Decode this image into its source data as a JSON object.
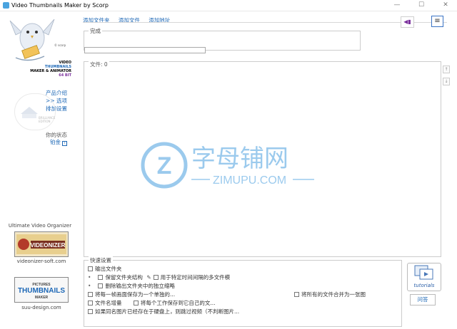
{
  "window": {
    "title": "Video Thumbnails Maker by Scorp",
    "minimize_glyph": "—",
    "maximize_glyph": "☐",
    "close_glyph": "✕"
  },
  "sidebar": {
    "scorp_label": "© scorp",
    "logo_lines": [
      "VIDEO",
      "THUMBNAILS",
      "MAKER & ANIMATOR",
      "64 BIT"
    ],
    "product_intro": "产品介绍",
    "options": ">> 选项",
    "reset": "排加设置",
    "edition_text": [
      "BRILLIANCE",
      "EDITION"
    ],
    "your_status": "你的状态",
    "platinum": "铂金",
    "info_glyph": "i",
    "org_label": "Ultimate Video Organizer",
    "videonizer_logo_text": "VIDEONIZER",
    "videonizer_link": "videonizer-soft.com",
    "ptm_logo_lines": [
      "PICTURES",
      "THUMBNAILS",
      "MAKER"
    ],
    "ptm_link": "suu-design.com"
  },
  "toolbar": {
    "add_folder": "添加文件夹",
    "add_file": "添加文件",
    "add_address": "添加地址"
  },
  "status": {
    "legend": "完成"
  },
  "files": {
    "label": "文件: 0"
  },
  "quick_settings": {
    "legend": "快速设置",
    "output_folder": "输出文件夹",
    "keep_structure": "保留文件夹结构",
    "multi_file_interval": "用于特定时间间隔的多文件模",
    "delete_thumbs": "删除输出文件夹中的独立缩略",
    "each_frame_separate": "将每一帧画面保存为一个单独的...",
    "merge_all": "将所有的文件合并为一张图",
    "file_name_inc": "文件名增量",
    "save_own_folder": "将每个工作保存到它自己的文...",
    "skip_if_exists": "如果同名图片已经存在于硬盘上，则跳过视频（不判断图片..."
  },
  "side_panel": {
    "tutorials_label": "tutorials",
    "help_button": "问答"
  },
  "watermark": {
    "letter": "Z",
    "chinese": "字母铺网",
    "domain": "ZIMUPU.COM"
  },
  "colors": {
    "accent_blue": "#1c67b6",
    "purple": "#7a2f9c",
    "watermark_blue": "#4a9fe0"
  }
}
